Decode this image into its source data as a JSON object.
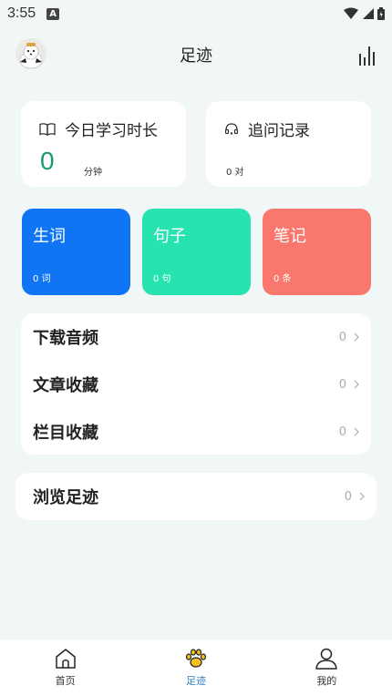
{
  "status_bar": {
    "time": "3:55",
    "notif_icon_letter": "A"
  },
  "header": {
    "title": "足迹"
  },
  "stats": {
    "study": {
      "title": "今日学习时长",
      "value": "0",
      "unit": "分钟"
    },
    "ask": {
      "title": "追问记录",
      "value": "0 对"
    }
  },
  "tiles": [
    {
      "title": "生词",
      "count": "0 词",
      "color": "#0f75f5"
    },
    {
      "title": "句子",
      "count": "0 句",
      "color": "#27e3b0"
    },
    {
      "title": "笔记",
      "count": "0 条",
      "color": "#f9776d"
    }
  ],
  "list": [
    {
      "label": "下载音频",
      "count": "0"
    },
    {
      "label": "文章收藏",
      "count": "0"
    },
    {
      "label": "栏目收藏",
      "count": "0"
    }
  ],
  "browse": {
    "label": "浏览足迹",
    "count": "0"
  },
  "tabs": [
    {
      "label": "首页"
    },
    {
      "label": "足迹"
    },
    {
      "label": "我的"
    }
  ]
}
